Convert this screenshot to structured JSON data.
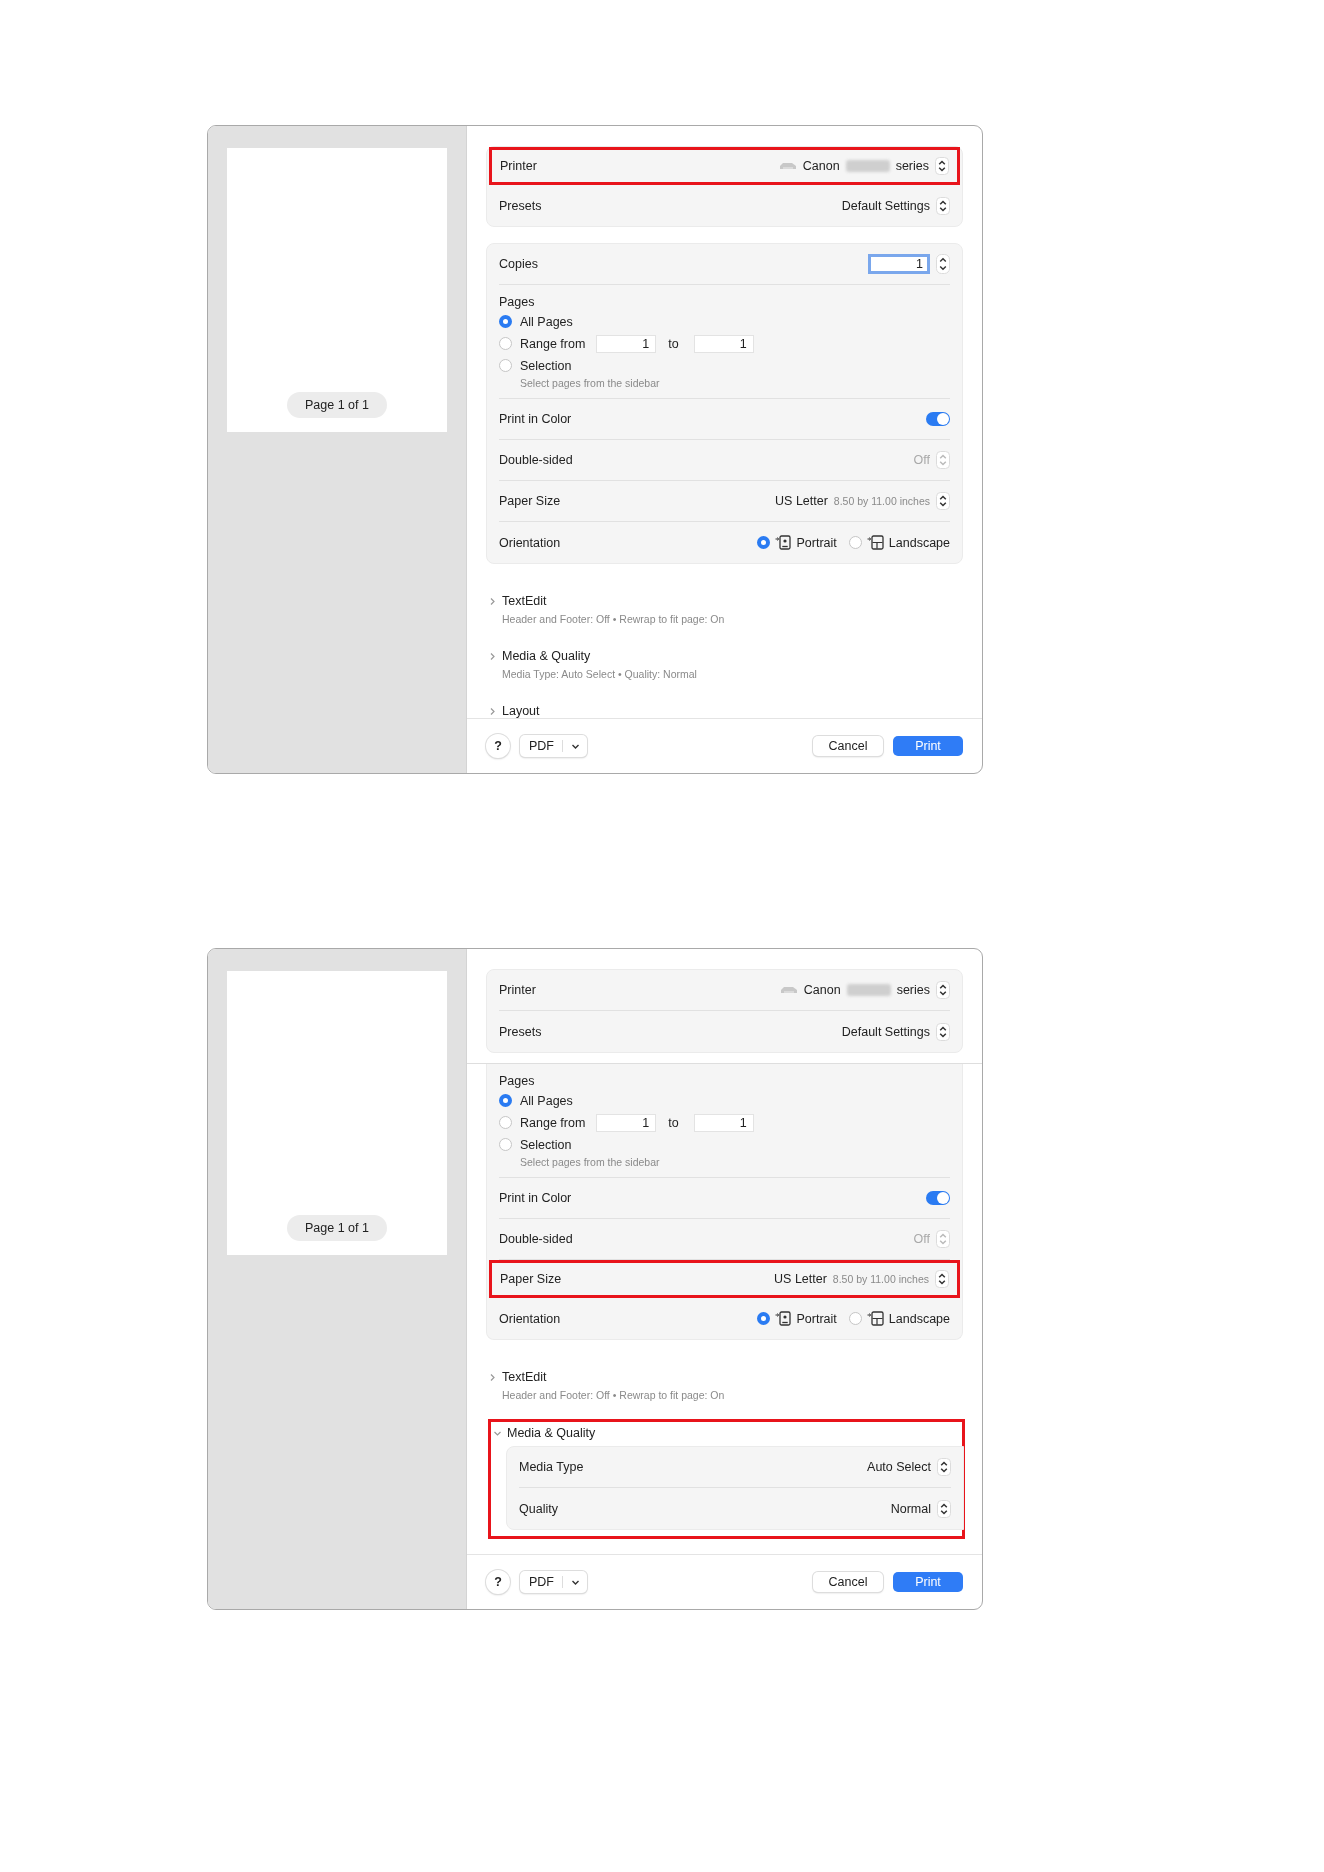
{
  "dialogs": [
    {
      "preview": {
        "page_label": "Page 1 of 1"
      },
      "printer_card": {
        "rows": [
          {
            "kind": "printer",
            "label": "Printer",
            "value": "Canon",
            "value_suffix": "series",
            "highlighted": true,
            "disabled": false
          },
          {
            "kind": "popup",
            "label": "Presets",
            "value": "Default Settings",
            "highlighted": false,
            "disabled": false
          }
        ]
      },
      "settings_card": {
        "clipped_top": false,
        "rows": [
          {
            "kind": "copies",
            "label": "Copies",
            "value": "1",
            "focused": true
          },
          {
            "kind": "pages",
            "label": "Pages",
            "options": [
              {
                "label": "All Pages",
                "selected": true
              },
              {
                "label": "Range from",
                "selected": false
              },
              {
                "label": "Selection",
                "selected": false
              }
            ],
            "range_from": "1",
            "to_label": "to",
            "range_to": "1",
            "hint": "Select pages from the sidebar"
          },
          {
            "kind": "toggle",
            "label": "Print in Color",
            "on": true
          },
          {
            "kind": "popup",
            "label": "Double-sided",
            "value": "Off",
            "disabled": true,
            "highlighted": false
          },
          {
            "kind": "popup",
            "label": "Paper Size",
            "value": "US Letter",
            "detail": "8.50 by 11.00 inches",
            "disabled": false,
            "highlighted": false
          },
          {
            "kind": "orientation",
            "label": "Orientation",
            "options": [
              {
                "kind": "portrait",
                "label": "Portrait",
                "selected": true
              },
              {
                "kind": "landscape",
                "label": "Landscape",
                "selected": false
              }
            ]
          }
        ]
      },
      "sections": [
        {
          "title": "TextEdit",
          "expanded": false,
          "highlighted": false,
          "summary": "Header and Footer: Off • Rewrap to fit page: On"
        },
        {
          "title": "Media & Quality",
          "expanded": false,
          "highlighted": false,
          "summary": "Media Type: Auto Select • Quality: Normal"
        },
        {
          "title": "Layout",
          "expanded": false,
          "highlighted": false
        }
      ],
      "footer": {
        "help": "?",
        "pdf": "PDF",
        "cancel": "Cancel",
        "print": "Print"
      }
    },
    {
      "preview": {
        "page_label": "Page 1 of 1"
      },
      "printer_card": {
        "rows": [
          {
            "kind": "printer",
            "label": "Printer",
            "value": "Canon",
            "value_suffix": "series",
            "highlighted": false,
            "disabled": false
          },
          {
            "kind": "popup",
            "label": "Presets",
            "value": "Default Settings",
            "highlighted": false,
            "disabled": false
          }
        ]
      },
      "settings_card": {
        "clipped_top": true,
        "rows": [
          {
            "kind": "pages",
            "label": "Pages",
            "options": [
              {
                "label": "All Pages",
                "selected": true
              },
              {
                "label": "Range from",
                "selected": false
              },
              {
                "label": "Selection",
                "selected": false
              }
            ],
            "range_from": "1",
            "to_label": "to",
            "range_to": "1",
            "hint": "Select pages from the sidebar"
          },
          {
            "kind": "toggle",
            "label": "Print in Color",
            "on": true
          },
          {
            "kind": "popup",
            "label": "Double-sided",
            "value": "Off",
            "disabled": true,
            "highlighted": false
          },
          {
            "kind": "popup",
            "label": "Paper Size",
            "value": "US Letter",
            "detail": "8.50 by 11.00 inches",
            "disabled": false,
            "highlighted": true
          },
          {
            "kind": "orientation",
            "label": "Orientation",
            "options": [
              {
                "kind": "portrait",
                "label": "Portrait",
                "selected": true
              },
              {
                "kind": "landscape",
                "label": "Landscape",
                "selected": false
              }
            ]
          }
        ]
      },
      "sections": [
        {
          "title": "TextEdit",
          "expanded": false,
          "highlighted": false,
          "summary": "Header and Footer: Off • Rewrap to fit page: On"
        },
        {
          "title": "Media & Quality",
          "expanded": true,
          "highlighted": true,
          "rows": [
            {
              "label": "Media Type",
              "value": "Auto Select"
            },
            {
              "label": "Quality",
              "value": "Normal"
            }
          ]
        }
      ],
      "footer": {
        "help": "?",
        "pdf": "PDF",
        "cancel": "Cancel",
        "print": "Print"
      }
    }
  ]
}
